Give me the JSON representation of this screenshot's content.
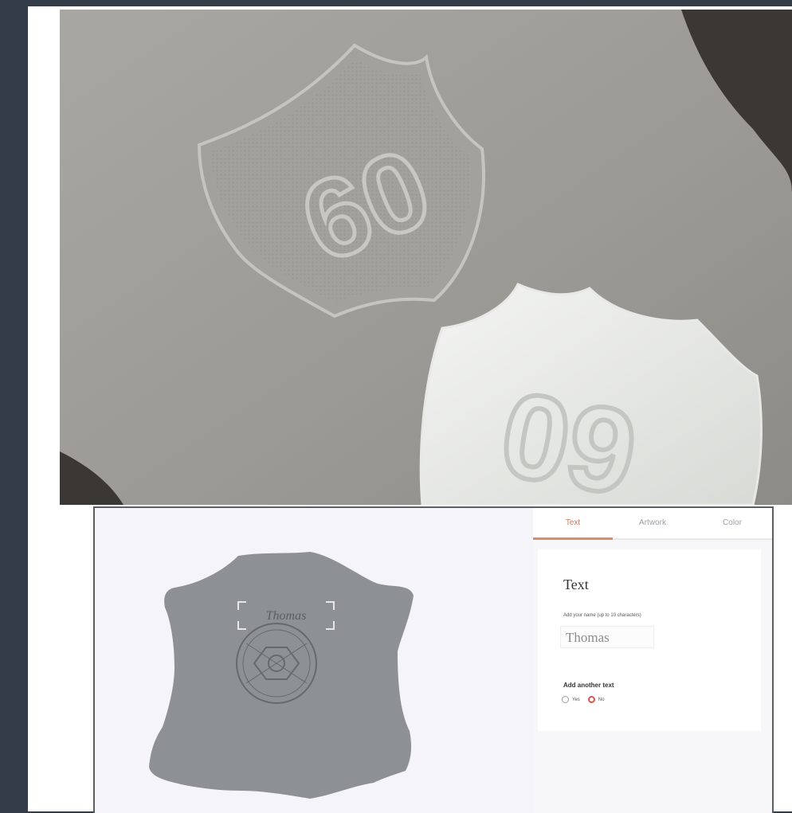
{
  "photo": {
    "badge_back_number": "60",
    "badge_front_number": "09"
  },
  "configurator": {
    "tabs": [
      {
        "label": "Text",
        "active": true
      },
      {
        "label": "Artwork",
        "active": false
      },
      {
        "label": "Color",
        "active": false
      }
    ],
    "panel": {
      "title": "Text",
      "help": "Add your name (up to 10 characters)",
      "name_value": "Thomas",
      "secondary_label": "Add another text",
      "options": [
        {
          "label": "Yes",
          "selected": false
        },
        {
          "label": "No",
          "selected": true
        }
      ]
    },
    "preview": {
      "engraved_name": "Thomas",
      "leather_color": "#8e9194"
    }
  },
  "colors": {
    "sidebar": "#343d47",
    "accent": "#d98c6d"
  }
}
